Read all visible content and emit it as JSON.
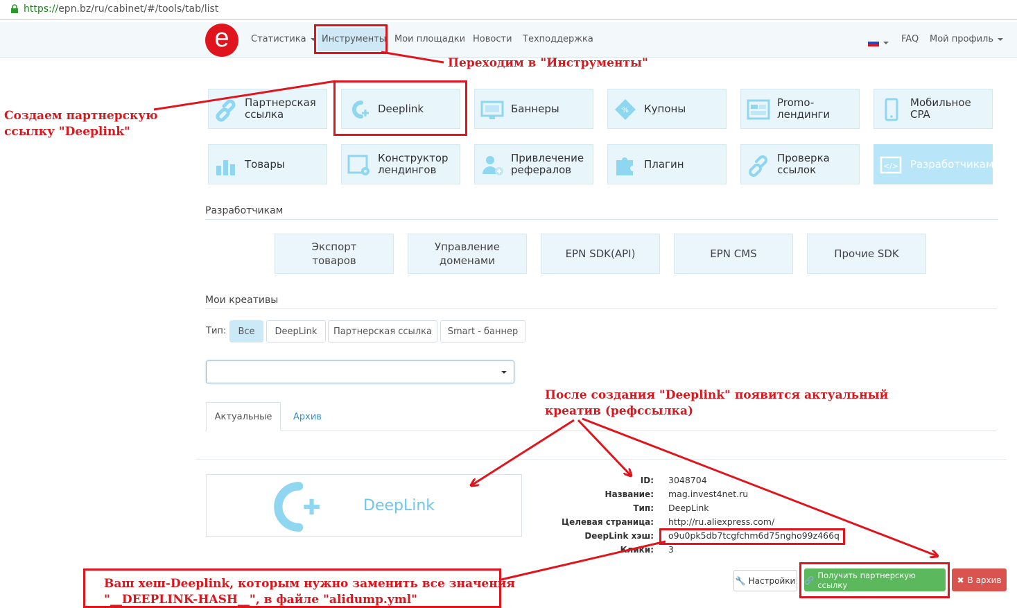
{
  "browser": {
    "url_scheme": "https://",
    "url_rest": "epn.bz/ru/cabinet/#/tools/tab/list"
  },
  "nav": {
    "logo": "e",
    "items": [
      "Статистика",
      "Инструменты",
      "Мои площадки",
      "Новости",
      "Техподдержка"
    ],
    "faq": "FAQ",
    "profile": "Мой профиль"
  },
  "tools": [
    {
      "label": "Партнерская ссылка",
      "icon": "link-icon"
    },
    {
      "label": "Deeplink",
      "icon": "deeplink-icon"
    },
    {
      "label": "Баннеры",
      "icon": "banner-icon"
    },
    {
      "label": "Купоны",
      "icon": "coupon-icon"
    },
    {
      "label": "Promo-лендинги",
      "icon": "landing-icon"
    },
    {
      "label": "Мобильное CPA",
      "icon": "mobile-icon"
    },
    {
      "label": "Товары",
      "icon": "goods-icon"
    },
    {
      "label": "Конструктор лендингов",
      "icon": "constructor-icon"
    },
    {
      "label": "Привлечение рефералов",
      "icon": "referral-icon"
    },
    {
      "label": "Плагин",
      "icon": "plugin-icon"
    },
    {
      "label": "Проверка ссылок",
      "icon": "link-check-icon"
    },
    {
      "label": "Разработчикам",
      "icon": "code-icon"
    }
  ],
  "dev_section": {
    "title": "Разработчикам",
    "items": [
      "Экспорт товаров",
      "Управление доменами",
      "EPN SDK(API)",
      "EPN CMS",
      "Прочие SDK"
    ]
  },
  "creatives": {
    "title": "Мои креативы",
    "type_label": "Тип:",
    "filters": [
      "Все",
      "DeepLink",
      "Партнерская ссылка",
      "Smart - баннер"
    ],
    "select_value": "",
    "tabs": [
      "Актуальные",
      "Архив"
    ],
    "card": {
      "banner_text": "DeepLink",
      "fields": [
        {
          "k": "ID:",
          "v": "3048704"
        },
        {
          "k": "Название:",
          "v": "mag.invest4net.ru"
        },
        {
          "k": "Тип:",
          "v": "DeepLink"
        },
        {
          "k": "Целевая страница:",
          "v": "http://ru.aliexpress.com/"
        },
        {
          "k": "DeepLink хэш:",
          "v": "o9u0pk5db7tcgfchm6d75ngho99z466q"
        },
        {
          "k": "Клики:",
          "v": "3"
        }
      ],
      "btn_settings": "Настройки",
      "btn_get_link": "Получить партнерскую ссылку",
      "btn_archive": "В архив"
    }
  },
  "annotations": {
    "go_tools": "Переходим в \"Инструменты\"",
    "create_line1": "Создаем партнерскую",
    "create_line2": "ссылку \"Deeplink\"",
    "after_line1": "После создания \"Deeplink\" появится актуальный",
    "after_line2": "креатив (рефссылка)",
    "hash_line1": "Ваш хеш-Deeplink, которым нужно заменить все значения",
    "hash_line2": "\"__DEEPLINK-HASH__\", в файле \"alidump.yml\""
  },
  "colors": {
    "accent": "#e0141c",
    "tile_bg": "#e8f5fb",
    "tile_icon": "#7fd0ef",
    "green": "#5cb85c",
    "danger": "#d9534f"
  }
}
